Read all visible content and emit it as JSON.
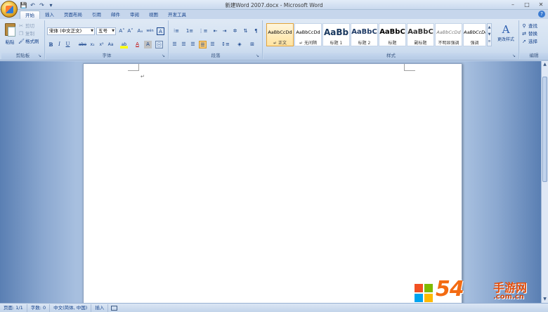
{
  "window": {
    "title": "新建Word 2007.docx - Microsoft Word",
    "controls": [
      "–",
      "□",
      "✕"
    ]
  },
  "qat": [
    "💾",
    "↶",
    "↷",
    "▾"
  ],
  "tabs": [
    {
      "label": "开始",
      "active": true
    },
    {
      "label": "插入"
    },
    {
      "label": "页面布局"
    },
    {
      "label": "引用"
    },
    {
      "label": "邮件"
    },
    {
      "label": "审阅"
    },
    {
      "label": "视图"
    },
    {
      "label": "开发工具"
    }
  ],
  "help": "?",
  "clipboard": {
    "paste": "粘贴",
    "cut": "剪切",
    "copy": "复制",
    "format_painter": "格式刷",
    "group_label": "剪贴板"
  },
  "font": {
    "font_name": "宋体 (中文正文)",
    "font_size": "五号",
    "group_label": "字体",
    "btn_grow": "A˄",
    "btn_shrink": "A˅",
    "btn_clear": "Aₓ",
    "btn_phonetic": "wén",
    "btn_border": "A",
    "bold": "B",
    "italic": "I",
    "underline": "U",
    "strike": "abe",
    "subscript": "x₂",
    "superscript": "x²",
    "case": "Aa",
    "highlight": "ab",
    "color": "A",
    "shade": "A"
  },
  "paragraph": {
    "group_label": "段落"
  },
  "styles": {
    "group_label": "样式",
    "items": [
      {
        "sample": "AaBbCcDd",
        "name": "↵ 正文",
        "selected": true
      },
      {
        "sample": "AaBbCcDd",
        "name": "↵ 无间隔"
      },
      {
        "sample": "AaBb",
        "name": "标题 1"
      },
      {
        "sample": "AaBbC",
        "name": "标题 2"
      },
      {
        "sample": "AaBbC",
        "name": "标题"
      },
      {
        "sample": "AaBbC",
        "name": "副标题"
      },
      {
        "sample": "AaBbCcDd",
        "name": "不明显强调"
      },
      {
        "sample": "AaBbCcDd",
        "name": "强调"
      }
    ],
    "change_styles": "更改样式",
    "change_icon": "A"
  },
  "editing": {
    "find": "查找",
    "replace": "替换",
    "select": "选择",
    "group_label": "编辑"
  },
  "document": {
    "para_mark": "↵"
  },
  "status": {
    "page": "页面: 1/1",
    "words": "字数: 0",
    "language": "中文(简体, 中国)",
    "mode": "插入"
  },
  "watermark": {
    "number": "54",
    "site_name": "手游网",
    "url": ".com.cn"
  }
}
